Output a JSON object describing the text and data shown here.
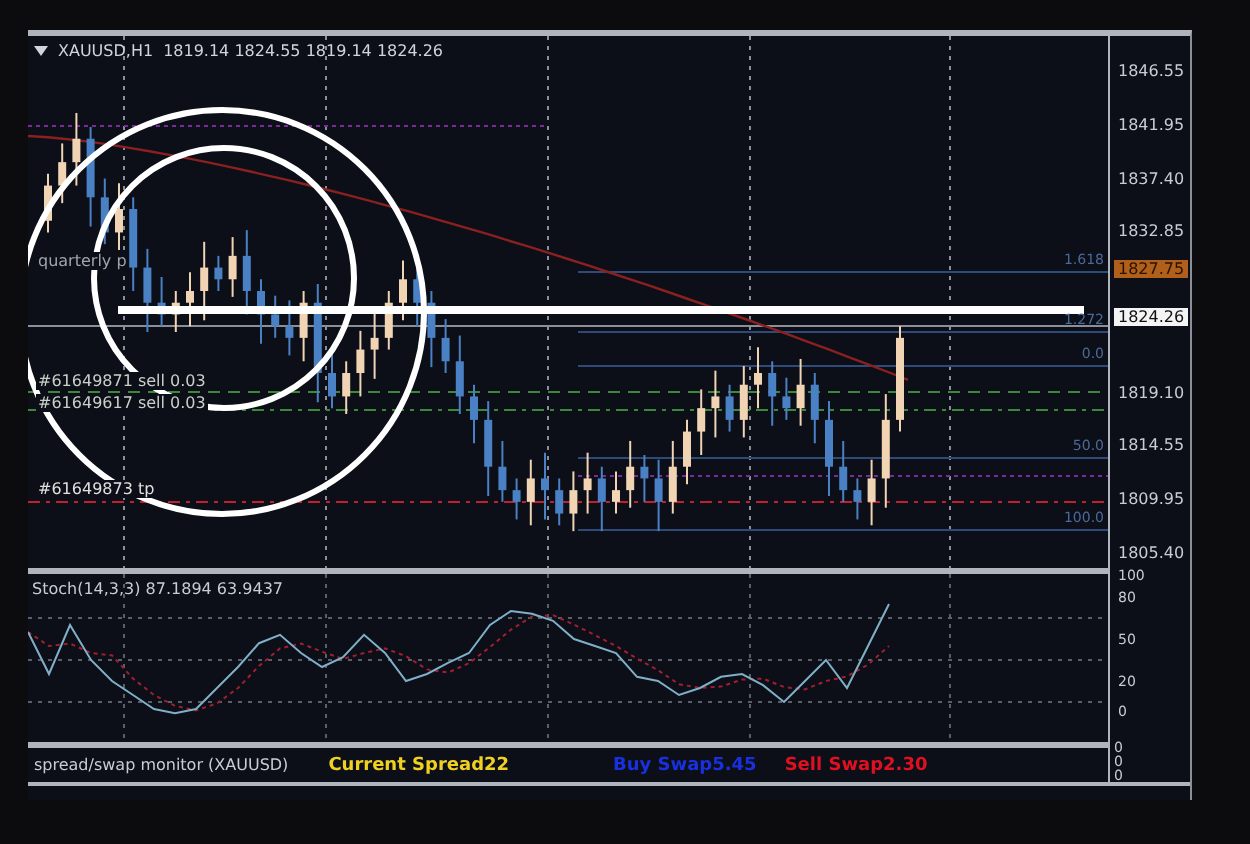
{
  "chart": {
    "symbol": "XAUUSD,H1",
    "ohlc": "1819.14 1824.55 1819.14 1824.26",
    "line_labels": [
      {
        "kind": "pivot",
        "text": "quarterly p"
      },
      {
        "kind": "order",
        "text": "#61649871 sell 0.03"
      },
      {
        "kind": "order",
        "text": "#61649617 sell 0.03"
      },
      {
        "kind": "tp",
        "text": "#61649873 tp"
      }
    ],
    "fib_levels": [
      "1.618",
      "1.272",
      "0.0",
      "50.0",
      "100.0"
    ],
    "price_axis": [
      "1846.55",
      "1841.95",
      "1837.40",
      "1832.85",
      "1819.10",
      "1814.55",
      "1809.95",
      "1805.40"
    ],
    "ask_badge": "1827.75",
    "bid_badge": "1824.26"
  },
  "stochastic": {
    "title": "Stoch(14,3,3) 87.1894 63.9437",
    "axis": [
      "100",
      "80",
      "50",
      "20",
      "0"
    ]
  },
  "spread_monitor": {
    "title": "spread/swap monitor (XAUUSD)",
    "items": [
      {
        "kind": "spread",
        "text": "Current Spread22"
      },
      {
        "kind": "buy",
        "text": "Buy Swap5.45"
      },
      {
        "kind": "sell",
        "text": "Sell Swap2.30"
      }
    ],
    "axis": [
      "0",
      "0",
      "0"
    ]
  }
}
